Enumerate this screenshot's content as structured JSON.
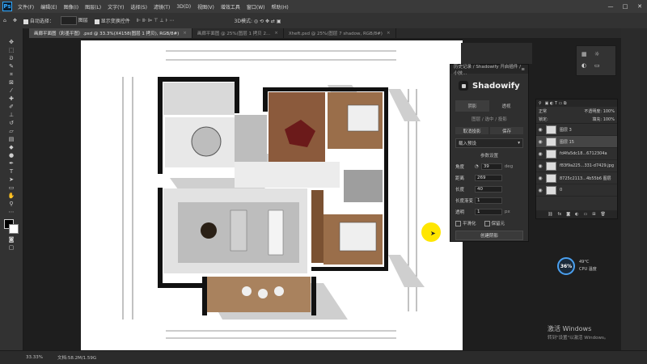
{
  "menubar": {
    "logo": "Ps",
    "items": [
      "文件(F)",
      "编辑(E)",
      "图像(I)",
      "图层(L)",
      "文字(Y)",
      "选择(S)",
      "滤镜(T)",
      "3D(D)",
      "视图(V)",
      "增效工具",
      "窗口(W)",
      "帮助(H)"
    ]
  },
  "options": {
    "auto_select": "自动选择：",
    "layer_label": "图层",
    "transform": "显示变换控件"
  },
  "tabs": [
    {
      "label": "画廊平面图（彩墨平图）.psd @ 33.3%(X4158(图层 1 拷贝), RGB/8#)",
      "active": true
    },
    {
      "label": "画廊平面图 @ 25%(图层 1 拷贝 2...",
      "active": false
    },
    {
      "label": "Xheft.psd @ 25%(图层 7 shadow, RGB/8#)",
      "active": false
    }
  ],
  "shadowify": {
    "panel_title": "历史记录 / Shadowify 开启插件 / 小技...",
    "name": "Shadowify",
    "tab_a": "阴影",
    "tab_b": "透视",
    "layer_hint": "图层 / 选中 / 投影",
    "btn_a": "取消投影",
    "btn_b": "保存",
    "preset": "载入预设",
    "section": "参数设置",
    "params": [
      {
        "label": "角度",
        "value": "39",
        "unit": "deg"
      },
      {
        "label": "距离",
        "value": "269",
        "unit": ""
      },
      {
        "label": "长度",
        "value": "40",
        "unit": ""
      },
      {
        "label": "长度渐变",
        "value": "1",
        "unit": ""
      },
      {
        "label": "透明",
        "value": "1",
        "unit": "px"
      }
    ],
    "check_a": "平滑化",
    "check_b": "保留元",
    "apply": "创建阴影"
  },
  "layers": {
    "rows": [
      {
        "name": "图层 3",
        "selected": false
      },
      {
        "name": "图层 15",
        "selected": true
      },
      {
        "name": "fd4fa5dc18...6712304a",
        "selected": false
      },
      {
        "name": "f83f9a225...331-d7429.jpg",
        "selected": false
      },
      {
        "name": "8725c2113...4b55b6 图层",
        "selected": false
      },
      {
        "name": "0",
        "selected": false
      }
    ],
    "blend": "正常",
    "opacity": "不透明度: 100%",
    "fill": "填充: 100%",
    "lock": "锁定:"
  },
  "status": {
    "zoom": "33.33%",
    "doc": "文档:58.2M/1.59G"
  },
  "perf": {
    "percent": "36%",
    "line1": "49°C",
    "line2": "CPU 温度"
  },
  "watermark": {
    "line1": "激活 Windows",
    "line2": "转到\"设置\"以激活 Windows。"
  }
}
